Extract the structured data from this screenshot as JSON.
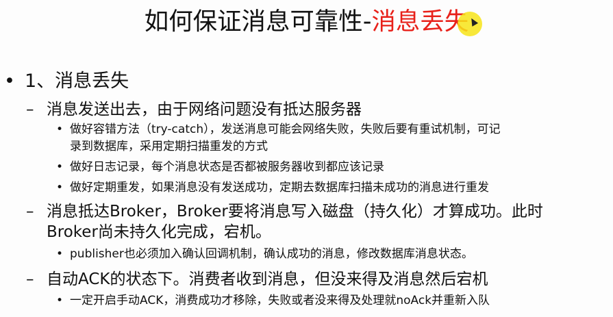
{
  "slide": {
    "title_main": "如何保证消息可靠性-",
    "title_accent": "消息丢失",
    "accent_color": "#e8211a",
    "sections": [
      {
        "level1": "1、消息丢失"
      }
    ],
    "items": [
      {
        "heading": "消息发送出去，由于网络问题没有抵达服务器",
        "subs": [
          "做好容错方法（try-catch），发送消息可能会网络失败，失败后要有重试机制，可记",
          "录到数据库，采用定期扫描重发的方式",
          "做好日志记录，每个消息状态是否都被服务器收到都应该记录",
          "做好定期重发，如果消息没有发送成功，定期去数据库扫描未成功的消息进行重发"
        ]
      },
      {
        "heading_line1": "消息抵达Broker，Broker要将消息写入磁盘（持久化）才算成功。此时",
        "heading_line2": "Broker尚未持久化完成，宕机。",
        "subs": [
          "publisher也必须加入确认回调机制，确认成功的消息，修改数据库消息状态。"
        ]
      },
      {
        "heading": "自动ACK的状态下。消费者收到消息，但没来得及消息然后宕机",
        "subs": [
          "一定开启手动ACK，消费成功才移除，失败或者没来得及处理就noAck并重新入队"
        ]
      }
    ],
    "bullet_l1": "•",
    "bullet_l2": "–",
    "bullet_l3": "•"
  }
}
